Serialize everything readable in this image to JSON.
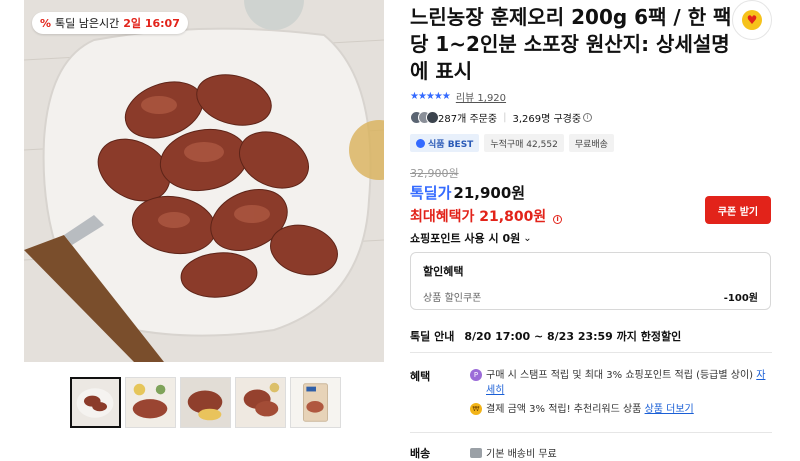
{
  "timer_badge": {
    "icon": "percent-icon",
    "label": "톡딜 남은시간",
    "time": "2일 16:07"
  },
  "thumbnails": [
    {
      "alt": "smoked-duck-plate"
    },
    {
      "alt": "smoked-duck-with-sauce"
    },
    {
      "alt": "smoked-duck-closeup"
    },
    {
      "alt": "smoked-duck-dish"
    },
    {
      "alt": "smoked-duck-package"
    }
  ],
  "product": {
    "title": "느린농장 훈제오리 200g 6팩 / 한 팩당 1~2인분 소포장 원산지: 상세설명에 표시",
    "rating_stars": "★★★★★",
    "review_label": "리뷰 1,920",
    "orders": "287개 주문중",
    "viewers": "3,269명 구경중",
    "tags": [
      "식품 BEST",
      "누적구매 42,552",
      "무료배송"
    ],
    "original_price": "32,900원",
    "deal_label": "톡딜가",
    "deal_price": "21,900원",
    "max_label": "최대혜택가",
    "max_price": "21,800원",
    "coupon_button": "쿠폰 받기",
    "points_label": "쇼핑포인트 사용 시 0원"
  },
  "discount": {
    "title": "할인혜택",
    "row_label": "상품 할인쿠폰",
    "row_value": "-100원"
  },
  "timedeal": {
    "label": "톡딜 안내",
    "period": "8/20 17:00 ~ 8/23 23:59 까지 한정할인"
  },
  "benefit": {
    "label": "혜택",
    "line1_text": "구매 시 스탬프 적립 및 최대 3% 쇼핑포인트 적립 (등급별 상이)",
    "line1_link": "자세히",
    "line2_text": "결제 금액 3% 적립! 추천리워드 상품",
    "line2_link": "상품 더보기"
  },
  "shipping": {
    "label": "배송",
    "value": "기본 배송비 무료"
  },
  "colors": {
    "accent_blue": "#346aff",
    "deal_red": "#e2231a"
  }
}
